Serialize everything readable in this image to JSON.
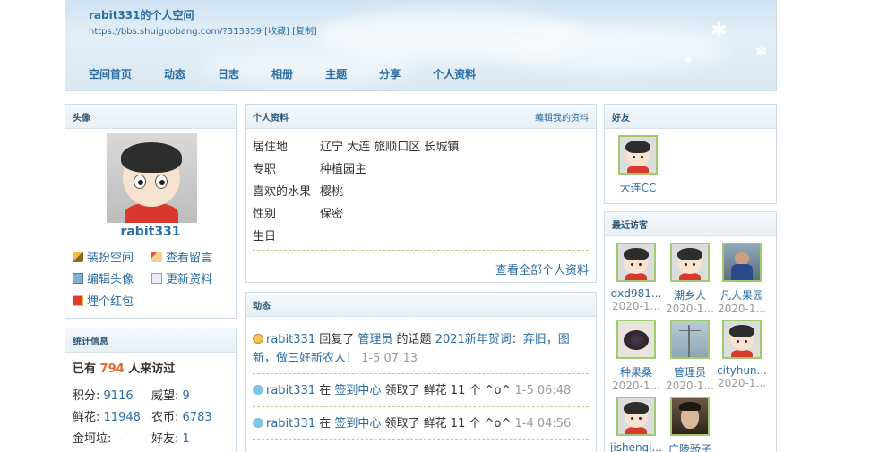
{
  "header": {
    "title": "rabit331的个人空间",
    "url": "https://bbs.shuiguobang.com/?313359",
    "favorite": "[收藏]",
    "copy": "[复制]"
  },
  "nav": [
    "空间首页",
    "动态",
    "日志",
    "相册",
    "主题",
    "分享",
    "个人资料"
  ],
  "avatar_panel": {
    "heading": "头像",
    "username": "rabit331",
    "actions": [
      "装扮空间",
      "查看留言",
      "编辑头像",
      "更新资料",
      "埋个红包"
    ]
  },
  "stats": {
    "heading": "统计信息",
    "visits_prefix": "已有",
    "visits": "794",
    "visits_suffix": "人来访过",
    "rows": [
      {
        "label": "积分:",
        "value": "9116"
      },
      {
        "label": "威望:",
        "value": "9"
      },
      {
        "label": "鲜花:",
        "value": "11948"
      },
      {
        "label": "农币:",
        "value": "6783"
      },
      {
        "label": "金坷垃:",
        "value": "--"
      },
      {
        "label": "好友:",
        "value": "1"
      }
    ]
  },
  "profile": {
    "heading": "个人资料",
    "edit": "编辑我的资料",
    "rows": [
      {
        "key": "居住地",
        "value": "辽宁 大连 旅顺口区 长城镇"
      },
      {
        "key": "专职",
        "value": "种植园主"
      },
      {
        "key": "喜欢的水果",
        "value": "樱桃"
      },
      {
        "key": "性别",
        "value": "保密"
      },
      {
        "key": "生日",
        "value": ""
      }
    ],
    "view_all": "查看全部个人资料"
  },
  "activity": {
    "heading": "动态",
    "items": [
      {
        "user": "rabit331",
        "verb": "回复了",
        "target": "管理员",
        "mid": "的话题",
        "topic": "2021新年贺词：弃旧，图新，做三好新农人！",
        "time": "1-5 07:13"
      },
      {
        "user": "rabit331",
        "verb": "在",
        "target": "签到中心",
        "mid": "领取了 鲜花 11 个 ^o^",
        "topic": "",
        "time": "1-5 06:48"
      },
      {
        "user": "rabit331",
        "verb": "在",
        "target": "签到中心",
        "mid": "领取了 鲜花 11 个 ^o^",
        "topic": "",
        "time": "1-4 04:56"
      }
    ]
  },
  "friends": {
    "heading": "好友",
    "items": [
      {
        "name": "大连CC"
      }
    ]
  },
  "visitors": {
    "heading": "最近访客",
    "items": [
      {
        "name": "dxd981...",
        "date": "2020-1..."
      },
      {
        "name": "潮乡人",
        "date": "2020-1..."
      },
      {
        "name": "凡人果园",
        "date": "2020-1..."
      },
      {
        "name": "种果桑",
        "date": "2020-1..."
      },
      {
        "name": "管理员",
        "date": "2020-1..."
      },
      {
        "name": "cityhun...",
        "date": "2020-1..."
      },
      {
        "name": "jishengj...",
        "date": ""
      },
      {
        "name": "广陵骄子",
        "date": ""
      }
    ]
  },
  "colors": {
    "link": "#2b6ca3",
    "accent_orange": "#e06a2c",
    "friend_border": "#9ecb6c"
  }
}
